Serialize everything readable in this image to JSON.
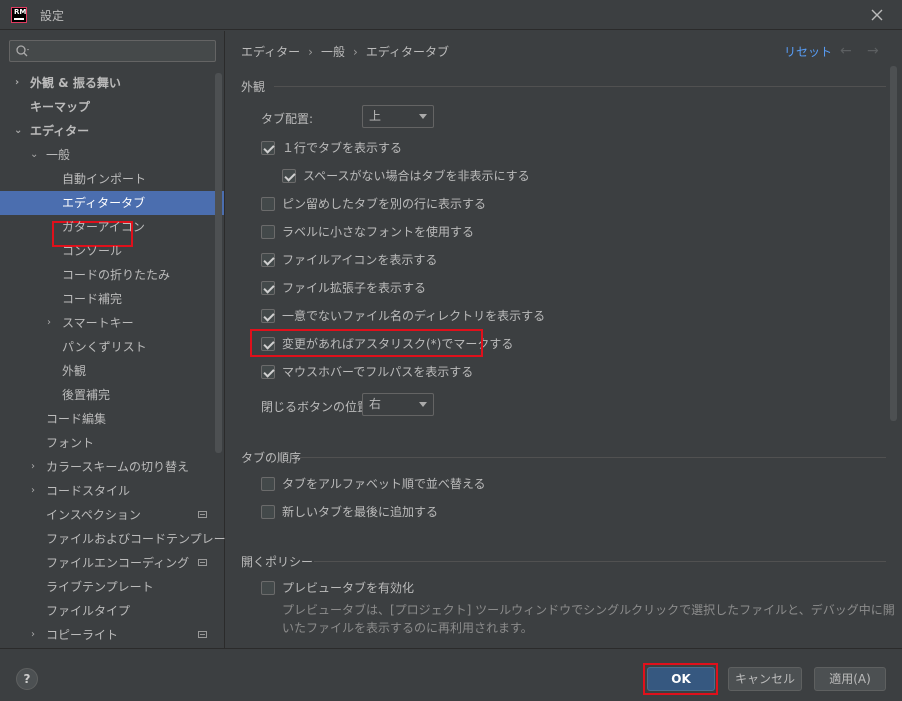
{
  "window": {
    "title": "設定",
    "logo_text": "RM"
  },
  "search": {
    "placeholder": "",
    "value": ""
  },
  "tree": [
    {
      "label": "外観 & 振る舞い",
      "arrow": "›",
      "bold": true
    },
    {
      "label": "キーマップ",
      "bold": true
    },
    {
      "label": "エディター",
      "arrow": "⌄",
      "bold": true
    },
    {
      "label": "一般",
      "arrow": "⌄"
    },
    {
      "label": "自動インポート"
    },
    {
      "label": "エディタータブ",
      "selected": true
    },
    {
      "label": "ガターアイコン"
    },
    {
      "label": "コンソール"
    },
    {
      "label": "コードの折りたたみ"
    },
    {
      "label": "コード補完"
    },
    {
      "label": "スマートキー",
      "arrow": "›"
    },
    {
      "label": "パンくずリスト"
    },
    {
      "label": "外観"
    },
    {
      "label": "後置補完"
    },
    {
      "label": "コード編集"
    },
    {
      "label": "フォント"
    },
    {
      "label": "カラースキームの切り替え",
      "arrow": "›"
    },
    {
      "label": "コードスタイル",
      "arrow": "›"
    },
    {
      "label": "インスペクション",
      "badge": true
    },
    {
      "label": "ファイルおよびコードテンプレート"
    },
    {
      "label": "ファイルエンコーディング",
      "badge": true
    },
    {
      "label": "ライブテンプレート"
    },
    {
      "label": "ファイルタイプ"
    },
    {
      "label": "コピーライト",
      "arrow": "›",
      "badge": true
    }
  ],
  "breadcrumb": {
    "items": [
      "エディター",
      "一般",
      "エディタータブ"
    ],
    "separator": "›"
  },
  "header": {
    "reset_label": "リセット",
    "back_icon": "←",
    "forward_icon": "→"
  },
  "appearance": {
    "title": "外観",
    "tab_placement_label": "タブ配置:",
    "tab_placement_value": "上",
    "show_in_one_row": {
      "label": "１行でタブを表示する",
      "checked": true
    },
    "hide_when_no_space": {
      "label": "スペースがない場合はタブを非表示にする",
      "checked": true
    },
    "pinned_separate_row": {
      "label": "ピン留めしたタブを別の行に表示する",
      "checked": false
    },
    "small_font_labels": {
      "label": "ラベルに小さなフォントを使用する",
      "checked": false
    },
    "show_file_icon": {
      "label": "ファイルアイコンを表示する",
      "checked": true
    },
    "show_extension": {
      "label": "ファイル拡張子を表示する",
      "checked": true
    },
    "show_directory": {
      "label": "一意でないファイル名のディレクトリを表示する",
      "checked": true
    },
    "mark_modified": {
      "label": "変更があればアスタリスク(*)でマークする",
      "checked": true
    },
    "full_path_hover": {
      "label": "マウスホバーでフルパスを表示する",
      "checked": true
    },
    "close_button_label": "閉じるボタンの位置:",
    "close_button_value": "右"
  },
  "tab_order": {
    "title": "タブの順序",
    "sort_alpha": {
      "label": "タブをアルファベット順で並べ替える",
      "checked": false
    },
    "open_last": {
      "label": "新しいタブを最後に追加する",
      "checked": false
    }
  },
  "opening_policy": {
    "title": "開くポリシー",
    "enable_preview": {
      "label": "プレビュータブを有効化",
      "checked": false
    },
    "description": "プレビュータブは、[プロジェクト] ツールウィンドウでシングルクリックで選択したファイルと、デバッグ中に開いたファイルを表示するのに再利用されます。"
  },
  "footer": {
    "help_label": "?",
    "ok_label": "OK",
    "cancel_label": "キャンセル",
    "apply_label": "適用(A)"
  }
}
